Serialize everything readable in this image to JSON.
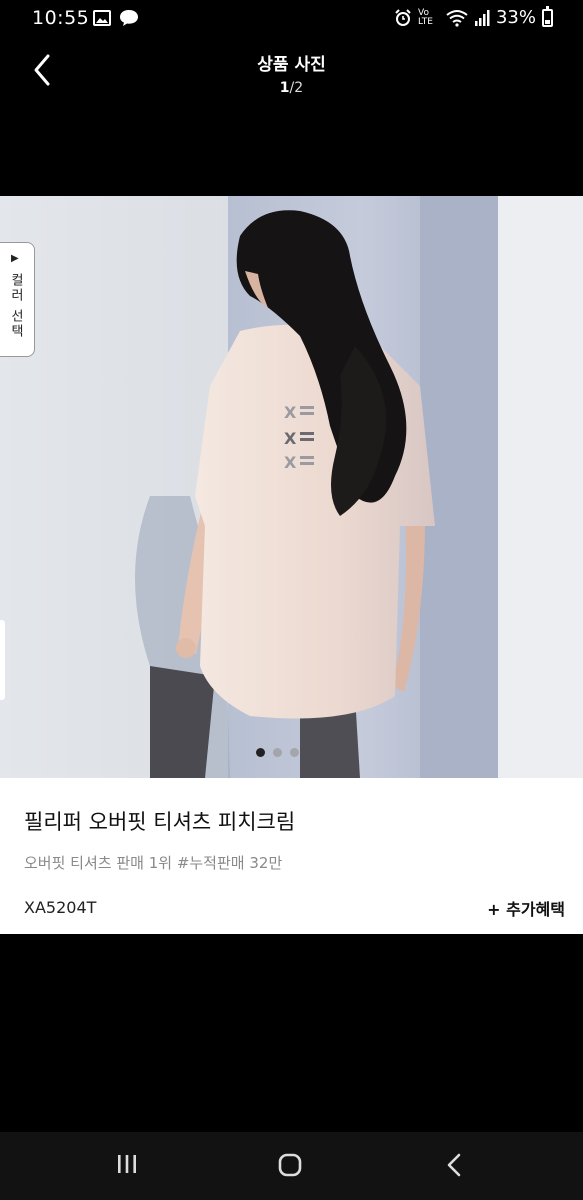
{
  "status_bar": {
    "time": "10:55",
    "network": "Vo LTE",
    "battery": "33%",
    "battery_level": 0.33
  },
  "header": {
    "title": "상품 사진",
    "counter_current": "1",
    "counter_sep": "/",
    "counter_total": "2"
  },
  "photo": {
    "color_select_arrow": "▶",
    "color_select_label": "컬러 선택",
    "dots_count": 3,
    "active_dot": 0,
    "shirt_print": "X"
  },
  "product": {
    "name": "필리퍼 오버핏 티셔츠 피치크림",
    "subtitle": "오버핏 티셔츠 판매 1위 #누적판매 32만",
    "code": "XA5204T",
    "benefit_label": "+ 추가혜택"
  },
  "colors": {
    "background": "#000000",
    "card": "#ffffff",
    "nav_bar": "#121212"
  }
}
